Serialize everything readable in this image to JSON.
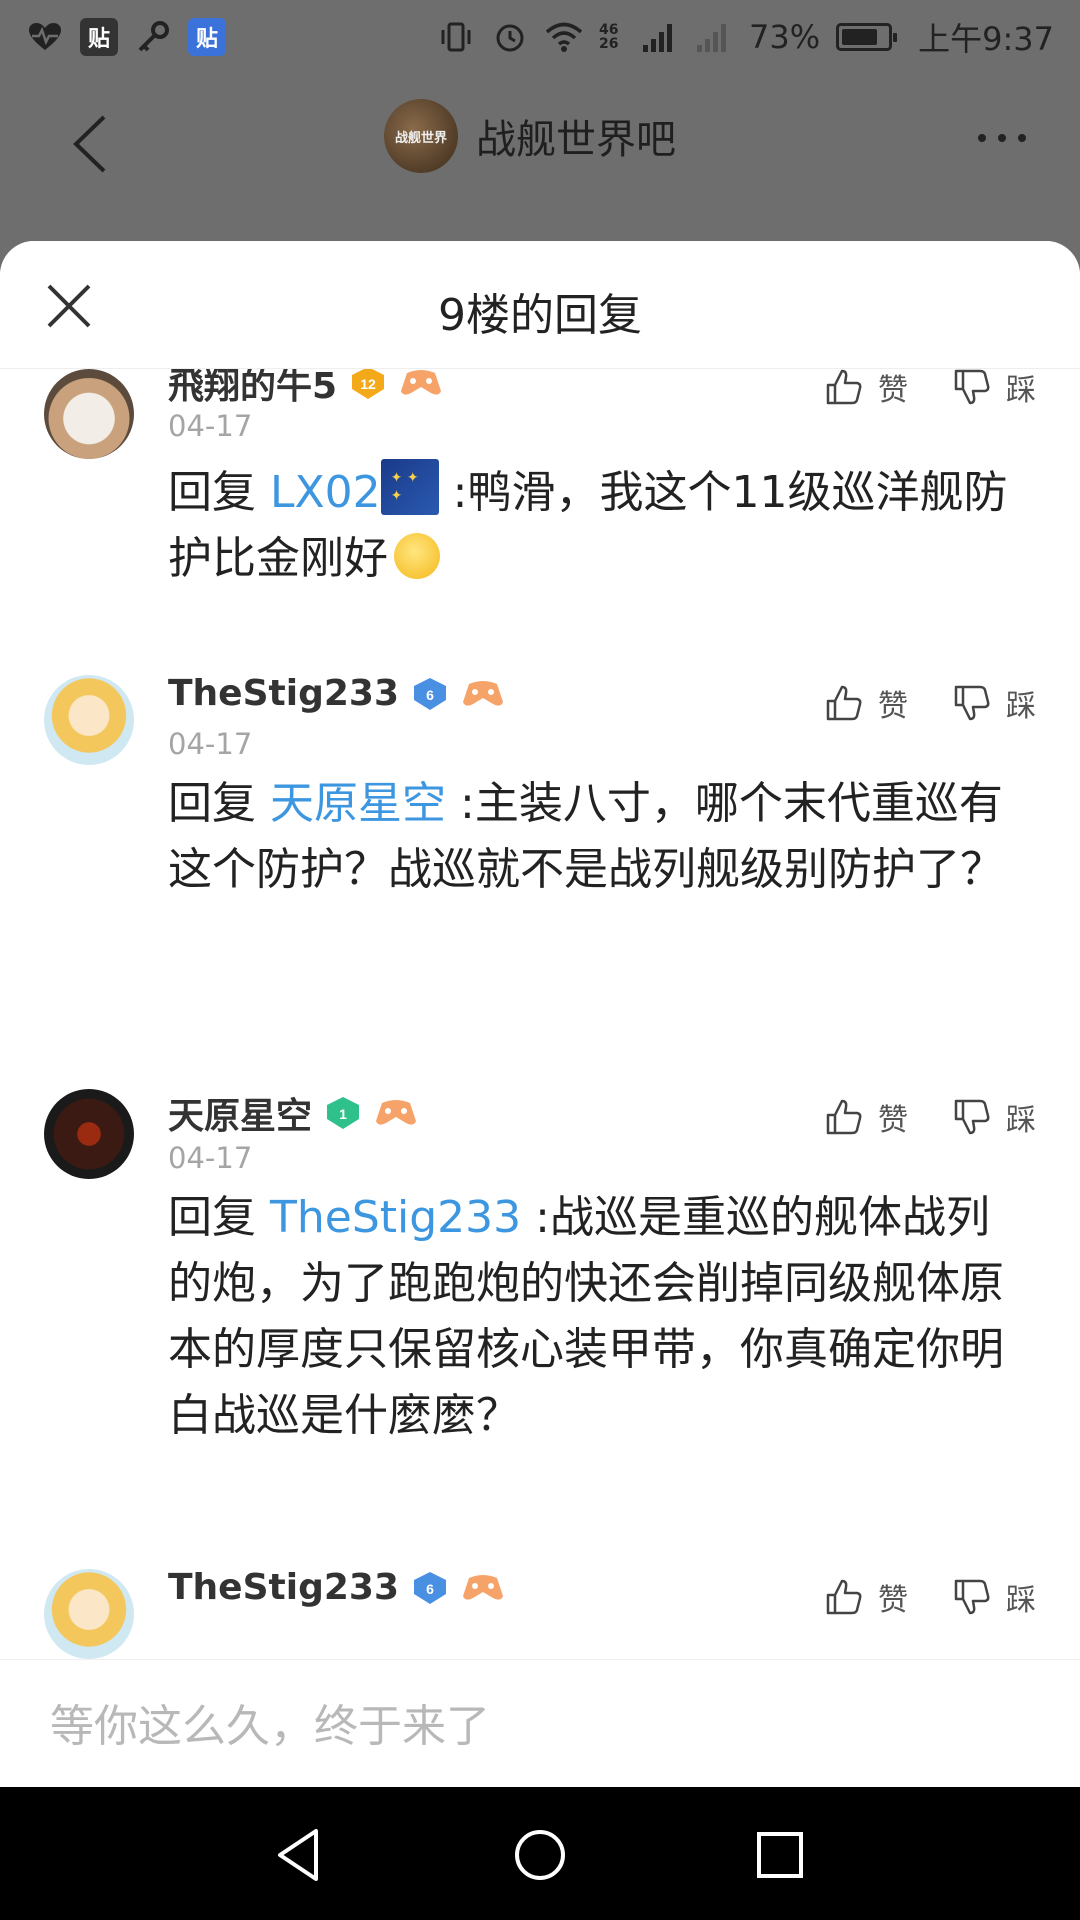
{
  "status_bar": {
    "left_icons": [
      "heart-pulse-icon",
      "tieba-icon",
      "key-icon",
      "tieba-alt-icon"
    ],
    "tie1": "贴",
    "tie2": "贴",
    "network_label": "46 26",
    "battery_percent": "73%",
    "time": "上午9:37"
  },
  "background_page": {
    "forum_name": "战舰世界吧",
    "forum_avatar_text": "战舰世界"
  },
  "sheet": {
    "title": "9楼的回复"
  },
  "actions": {
    "like": "赞",
    "dislike": "踩"
  },
  "replies": [
    {
      "username": "飛翔的牛5",
      "level": "12",
      "badge_color": "#f3a91a",
      "date": "04-17",
      "prefix": "回复",
      "mention": "LX02",
      "text": ":鸭滑，我这个11级巡洋舰防护比金刚好"
    },
    {
      "username": "TheStig233",
      "level": "6",
      "badge_color": "#4a90e2",
      "date": "04-17",
      "prefix": "回复",
      "mention": "天原星空",
      "text": ":主装八寸，哪个末代重巡有这个防护？战巡就不是战列舰级别防护了？"
    },
    {
      "username": "天原星空",
      "level": "1",
      "badge_color": "#2fc18c",
      "date": "04-17",
      "prefix": "回复",
      "mention": "TheStig233",
      "text": ":战巡是重巡的舰体战列的炮，为了跑跑炮的快还会削掉同级舰体原本的厚度只保留核心装甲带，你真确定你明白战巡是什麼麼？"
    },
    {
      "username": "TheStig233",
      "level": "6",
      "badge_color": "#4a90e2"
    }
  ],
  "input": {
    "placeholder": "等你这么久，终于来了"
  }
}
